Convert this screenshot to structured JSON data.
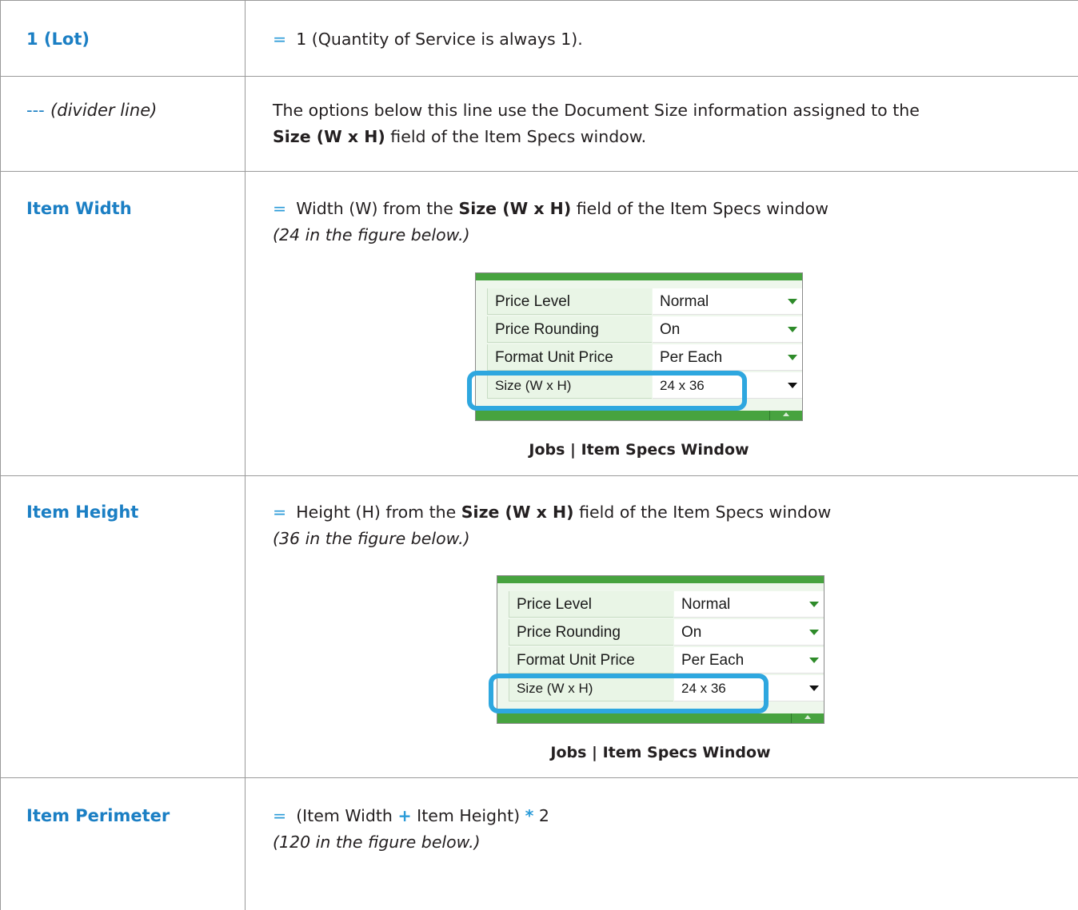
{
  "rows": [
    {
      "term": "1 (Lot)",
      "eq": "=",
      "text": "1 (Quantity of Service is always 1)."
    },
    {
      "term_dash": "---",
      "term_italic": "(divider line)",
      "line1": "The options below this line use the Document Size information assigned to the",
      "line2_bold": "Size (W x H)",
      "line2_rest": " field of the Item Specs window."
    },
    {
      "term": "Item Width",
      "eq": "=",
      "pre": "Width (W) from the ",
      "bold": "Size (W x H)",
      "post": " field of the Item Specs window",
      "note": "(24 in the figure below.)"
    },
    {
      "term": "Item Height",
      "eq": "=",
      "pre": "Height (H) from the ",
      "bold": "Size (W x H)",
      "post": " field of the Item Specs window",
      "note": "(36 in the figure below.)"
    },
    {
      "term": "Item Perimeter",
      "eq": "=",
      "part1": "(Item Width ",
      "plus": "+",
      "part2": " Item Height) ",
      "times": "*",
      "part3": " 2",
      "note": "(120 in the figure below.)"
    }
  ],
  "item_specs": {
    "rows": [
      {
        "label": "Price Level",
        "value": "Normal"
      },
      {
        "label": "Price Rounding",
        "value": "On"
      },
      {
        "label": "Format Unit Price",
        "value": "Per Each"
      },
      {
        "label": "Size (W x H)",
        "value": "24 x 36"
      }
    ],
    "caption": "Jobs | Item Specs Window"
  },
  "colors": {
    "term_blue": "#1b7fc4",
    "highlight_blue": "#2ea7df",
    "window_green": "#47a33f"
  }
}
